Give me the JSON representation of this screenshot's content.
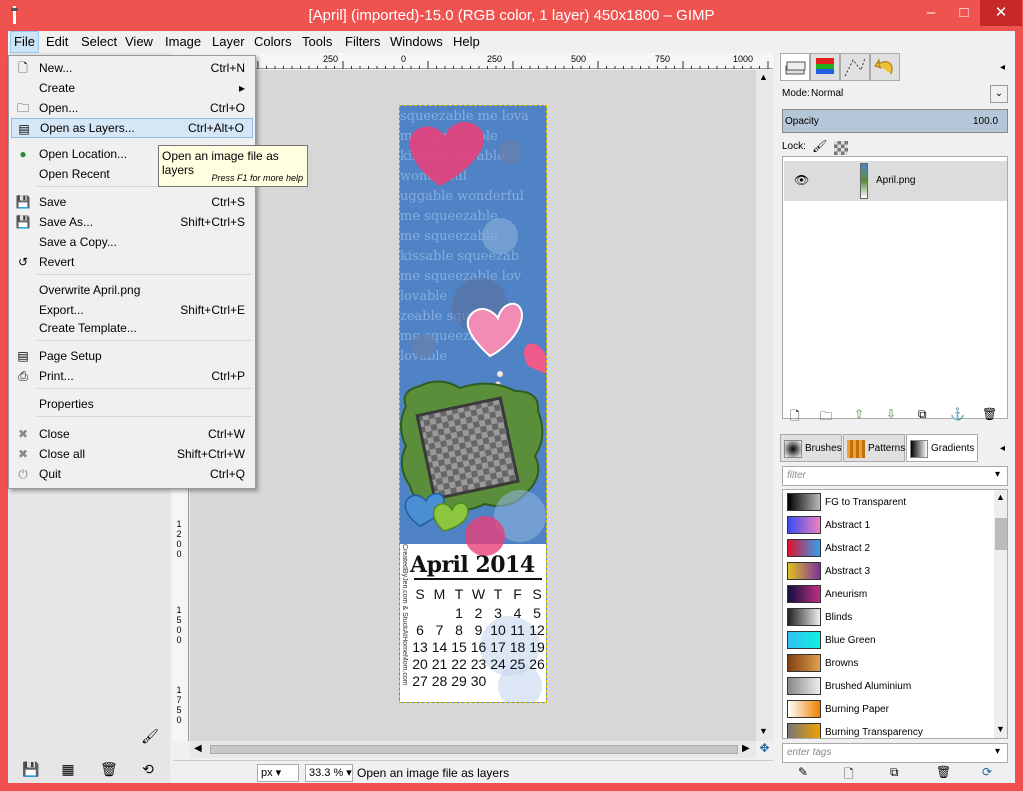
{
  "window": {
    "title": "[April] (imported)-15.0 (RGB color, 1 layer) 450x1800 – GIMP",
    "minimize": "–",
    "maximize": "□",
    "close": "✕"
  },
  "menubar": [
    "File",
    "Edit",
    "Select",
    "View",
    "Image",
    "Layer",
    "Colors",
    "Tools",
    "Filters",
    "Windows",
    "Help"
  ],
  "file_menu": [
    {
      "label": "New...",
      "accel": "Ctrl+N",
      "icon": "new-icon"
    },
    {
      "label": "Create",
      "accel": "",
      "icon": "",
      "submenu": true
    },
    {
      "label": "Open...",
      "accel": "Ctrl+O",
      "icon": "open-icon"
    },
    {
      "label": "Open as Layers...",
      "accel": "Ctrl+Alt+O",
      "icon": "open-layers-icon",
      "highlighted": true
    },
    {
      "label": "Open Location...",
      "accel": "",
      "icon": "globe-icon"
    },
    {
      "label": "Open Recent",
      "accel": "",
      "icon": ""
    },
    {
      "label": "Save",
      "accel": "Ctrl+S",
      "icon": "save-icon"
    },
    {
      "label": "Save As...",
      "accel": "Shift+Ctrl+S",
      "icon": "save-as-icon"
    },
    {
      "label": "Save a Copy...",
      "accel": "",
      "icon": ""
    },
    {
      "label": "Revert",
      "accel": "",
      "icon": "revert-icon"
    },
    {
      "label": "Overwrite April.png",
      "accel": "",
      "icon": ""
    },
    {
      "label": "Export...",
      "accel": "Shift+Ctrl+E",
      "icon": ""
    },
    {
      "label": "Create Template...",
      "accel": "",
      "icon": ""
    },
    {
      "label": "Page Setup",
      "accel": "",
      "icon": "page-setup-icon"
    },
    {
      "label": "Print...",
      "accel": "Ctrl+P",
      "icon": "print-icon"
    },
    {
      "label": "Properties",
      "accel": "",
      "icon": ""
    },
    {
      "label": "Close",
      "accel": "Ctrl+W",
      "icon": "close-icon"
    },
    {
      "label": "Close all",
      "accel": "Shift+Ctrl+W",
      "icon": "close-all-icon"
    },
    {
      "label": "Quit",
      "accel": "Ctrl+Q",
      "icon": "quit-icon"
    }
  ],
  "tooltip": {
    "text": "Open an image file as layers",
    "hint": "Press F1 for more help"
  },
  "ruler": {
    "top_labels": [
      "250",
      "0",
      "250",
      "500",
      "750",
      "1000"
    ],
    "left_labels": [
      "1",
      "2",
      "0",
      "0",
      "1",
      "5",
      "0",
      "0",
      "1",
      "7",
      "5",
      "0"
    ]
  },
  "status": {
    "unit": "px",
    "zoom": "33.3 %",
    "message": "Open an image file as layers"
  },
  "layers": {
    "mode_label": "Mode:",
    "mode": "Normal",
    "opacity_label": "Opacity",
    "opacity": "100.0",
    "lock_label": "Lock:",
    "layer_name": "April.png"
  },
  "brushes_tabs": [
    "Brushes",
    "Patterns",
    "Gradients"
  ],
  "gradients": {
    "filter_placeholder": "filter",
    "tags_placeholder": "enter tags",
    "items": [
      {
        "name": "FG to Transparent",
        "c1": "#000000",
        "c2": "#bbbbbb"
      },
      {
        "name": "Abstract 1",
        "c1": "#3a4cf0",
        "c2": "#f080c0"
      },
      {
        "name": "Abstract 2",
        "c1": "#e01030",
        "c2": "#30a0f0"
      },
      {
        "name": "Abstract 3",
        "c1": "#e0c020",
        "c2": "#8030a0"
      },
      {
        "name": "Aneurism",
        "c1": "#101040",
        "c2": "#c03080"
      },
      {
        "name": "Blinds",
        "c1": "#222222",
        "c2": "#eeeeee"
      },
      {
        "name": "Blue Green",
        "c1": "#30c0f0",
        "c2": "#10f0e0"
      },
      {
        "name": "Browns",
        "c1": "#804010",
        "c2": "#e0a050"
      },
      {
        "name": "Brushed Aluminium",
        "c1": "#888888",
        "c2": "#eeeeee"
      },
      {
        "name": "Burning Paper",
        "c1": "#ffffff",
        "c2": "#f08000"
      },
      {
        "name": "Burning Transparency",
        "c1": "#777777",
        "c2": "#f0a000"
      }
    ]
  },
  "image": {
    "bg_color": "#4f83c6",
    "calendar_title": "April 2014",
    "calendar_days": [
      "S",
      "M",
      "T",
      "W",
      "T",
      "F",
      "S"
    ],
    "calendar_rows": [
      [
        "",
        "",
        "1",
        "2",
        "3",
        "4",
        "5"
      ],
      [
        "6",
        "7",
        "8",
        "9",
        "10",
        "11",
        "12"
      ],
      [
        "13",
        "14",
        "15",
        "16",
        "17",
        "18",
        "19"
      ],
      [
        "20",
        "21",
        "22",
        "23",
        "24",
        "25",
        "26"
      ],
      [
        "27",
        "28",
        "29",
        "30",
        "",
        "",
        ""
      ]
    ],
    "side_text": "CreatedByJen.com & StuckAtHomeMom.com",
    "wordart": "squeezable me lovable kissable wonderful"
  }
}
